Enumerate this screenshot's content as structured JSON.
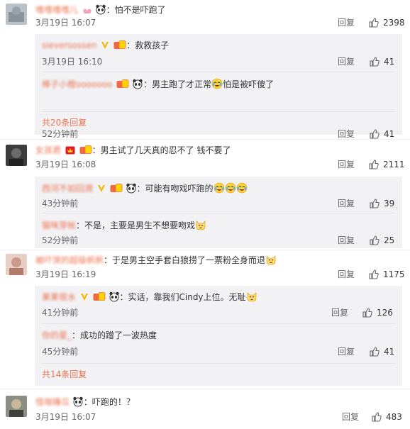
{
  "like_text": "",
  "comments": [
    {
      "user": "嗜嗜嗜嗜儿",
      "text": "：怕不是吓跑了",
      "time": "3月19日 16:07",
      "reply": "回复",
      "likes": "2398",
      "replies": [
        {
          "user": "sieversossen",
          "text": "：救救孩子",
          "time": "3月19日 16:10",
          "reply": "回复",
          "likes": "41"
        },
        {
          "user": "棒子小橙ooooooo",
          "text": "：男主跑了才正常",
          "text2": "怕是被吓傻了",
          "time": "52分钟前",
          "reply": "回复",
          "likes": "41"
        }
      ],
      "more": "共20条回复"
    },
    {
      "user": "女孩君",
      "text": "：男主试了几天真的忍不了 钱不要了",
      "time": "3月19日 16:08",
      "reply": "回复",
      "likes": "2111",
      "replies": [
        {
          "user": "西河不如回溯",
          "text": "：可能有吻戏吓跑的",
          "time": "43分钟前",
          "reply": "回复",
          "likes": "39"
        },
        {
          "user": "猫咪芽帐",
          "text": "：不是，主要是男生不想要吻戏",
          "time": "52分钟前",
          "reply": "回复",
          "likes": "25"
        }
      ]
    },
    {
      "user": "被吓哭的超级帆帆",
      "text": "：于是男主空手套白狼捞了一票粉全身而退",
      "time": "3月19日 16:19",
      "reply": "回复",
      "likes": "1175",
      "replies": [
        {
          "user": "果果很水",
          "text": "：实话，靠我们Cindy上位。无耻",
          "time": "41分钟前",
          "reply": "回复",
          "likes": "126"
        },
        {
          "user": "你的星_",
          "text": "：成功的蹭了一波热度",
          "time": "45分钟前",
          "reply": "回复",
          "likes": "41"
        }
      ],
      "more": "共14条回复"
    },
    {
      "user": "怪咖锤瓜",
      "text": "：吓跑的！？",
      "time": "3月19日 16:07",
      "reply": "回复",
      "likes": "483"
    }
  ]
}
